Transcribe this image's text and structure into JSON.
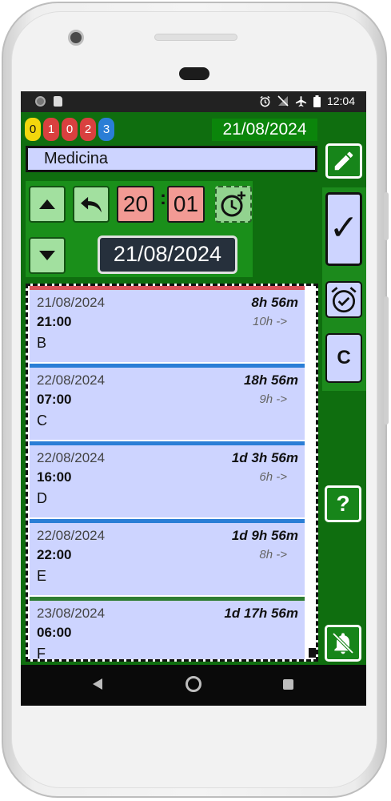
{
  "status_bar": {
    "time": "12:04",
    "icons": [
      "alarm-icon",
      "no-signal-icon",
      "airplane-icon",
      "battery-icon"
    ]
  },
  "badges": [
    {
      "value": "0",
      "color": "#f2d70d"
    },
    {
      "value": "1",
      "color": "#d9403f"
    },
    {
      "value": "0",
      "color": "#d9403f"
    },
    {
      "value": "2",
      "color": "#d9403f"
    },
    {
      "value": "3",
      "color": "#2a7ed6"
    }
  ],
  "header": {
    "date": "21/08/2024"
  },
  "name_field": {
    "value": "Medicina"
  },
  "controls": {
    "hour": "20",
    "minute": "01",
    "colon": ":",
    "date": "21/08/2024"
  },
  "side_buttons": {
    "check_label": "✓",
    "c_label": "C",
    "help_label": "?"
  },
  "list": [
    {
      "date": "21/08/2024",
      "remaining": "8h 56m",
      "time": "21:00",
      "interval": "10h ->",
      "name": "B",
      "color": "#d9535a"
    },
    {
      "date": "22/08/2024",
      "remaining": "18h 56m",
      "time": "07:00",
      "interval": "9h ->",
      "name": "C",
      "color": "#2a7ed6"
    },
    {
      "date": "22/08/2024",
      "remaining": "1d 3h 56m",
      "time": "16:00",
      "interval": "6h ->",
      "name": "D",
      "color": "#2a7ed6"
    },
    {
      "date": "22/08/2024",
      "remaining": "1d 9h 56m",
      "time": "22:00",
      "interval": "8h ->",
      "name": "E",
      "color": "#2a7ed6"
    },
    {
      "date": "23/08/2024",
      "remaining": "1d 17h 56m",
      "time": "06:00",
      "interval": "",
      "name": "F",
      "color": "#2e7d32"
    }
  ],
  "colors": {
    "app_background": "#0f6e0f",
    "list_item_bg": "#cdd4ff",
    "time_box_bg": "#f29a94",
    "control_button_bg": "#a2e09f"
  }
}
